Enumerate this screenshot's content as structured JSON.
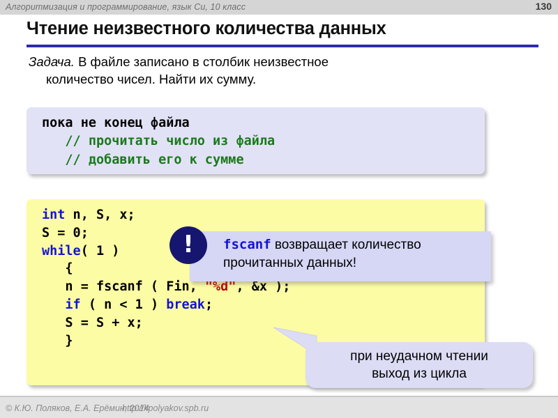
{
  "header": {
    "course_title": "Алгоритмизация и программирование, язык Си, 10 класс",
    "page_number": "130"
  },
  "slide": {
    "title": "Чтение неизвестного количества данных",
    "task_label": "Задача.",
    "task_line1": " В файле записано в столбик неизвестное",
    "task_line2": "количество чисел. Найти их сумму."
  },
  "pseudocode_block": {
    "lines": [
      {
        "text": "пока не конец файла",
        "kind": "plain"
      },
      {
        "text": "   // прочитать число из файла",
        "kind": "comment"
      },
      {
        "text": "   // добавить его к сумме",
        "kind": "comment"
      }
    ]
  },
  "code_block": {
    "line1_kw": "int",
    "line1_rest": " n, S, x;",
    "line2": "S = 0;",
    "line3_kw": "while",
    "line3_rest": "( 1 )",
    "line4": "   {",
    "line5_a": "   n = fscanf ( Fin, ",
    "line5_str": "\"%d\"",
    "line5_b": ", &x );",
    "line6_a": "   ",
    "line6_if": "if",
    "line6_b": " ( n < 1 ) ",
    "line6_break": "break",
    "line6_c": ";",
    "line7": "   S = S + x;",
    "line8": "   }"
  },
  "note_bubble": {
    "icon": "exclamation-icon",
    "icon_glyph": "!",
    "mono_word": "fscanf",
    "text_after": " возвращает количество",
    "line2": "прочитанных данных!"
  },
  "callout_bubble": {
    "line1": "при неудачном чтении",
    "line2": "выход из цикла"
  },
  "footer": {
    "copyright": "© К.Ю. Поляков, Е.А. Ерёмин, 2014",
    "url": "http://kpolyakov.spb.ru"
  },
  "colors": {
    "header_bar": "#d5d5d5",
    "title_rule": "#2b2bb0",
    "pseudo_bg": "#e2e2f7",
    "code_bg": "#fcfca5",
    "keyword": "#1414d2",
    "string": "#c40000",
    "comment": "#1a7a1a",
    "bubble_bg": "#d6d6f5",
    "icon_bg": "#161670",
    "footer_bg": "#e3e3e3"
  }
}
